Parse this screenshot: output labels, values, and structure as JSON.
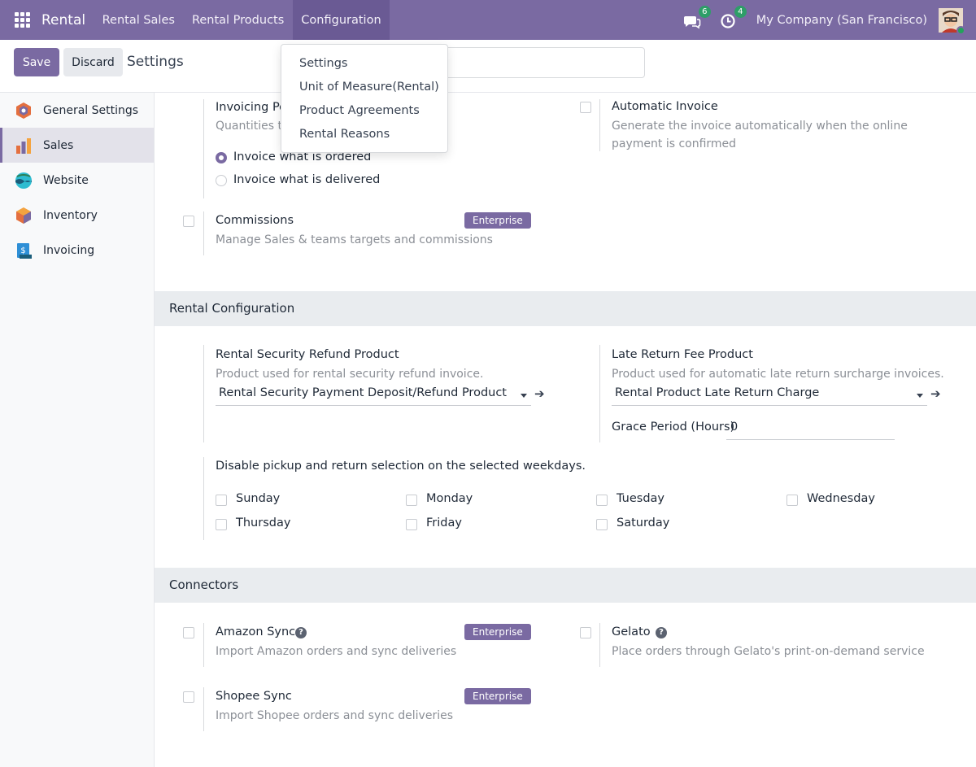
{
  "navbar": {
    "brand": "Rental",
    "menu": [
      "Rental Sales",
      "Rental Products",
      "Configuration"
    ],
    "messages_count": "6",
    "activities_count": "4",
    "company": "My Company (San Francisco)"
  },
  "dropdown": {
    "items": [
      "Settings",
      "Unit of Measure(Rental)",
      "Product Agreements",
      "Rental Reasons"
    ]
  },
  "control": {
    "save_label": "Save",
    "discard_label": "Discard",
    "breadcrumb": "Settings"
  },
  "sidebar": {
    "items": [
      {
        "label": "General Settings",
        "icon": "general-settings-icon",
        "active": false
      },
      {
        "label": "Sales",
        "icon": "sales-icon",
        "active": true
      },
      {
        "label": "Website",
        "icon": "website-icon",
        "active": false
      },
      {
        "label": "Inventory",
        "icon": "inventory-icon",
        "active": false
      },
      {
        "label": "Invoicing",
        "icon": "invoicing-icon",
        "active": false
      }
    ]
  },
  "invoicing_policy": {
    "title_partial": "Invoicing Po",
    "desc_partial": "Quantities t",
    "options": [
      "Invoice what is ordered",
      "Invoice what is delivered"
    ],
    "selected": 0
  },
  "automatic_invoice": {
    "title": "Automatic Invoice",
    "desc": "Generate the invoice automatically when the online payment is confirmed"
  },
  "commissions": {
    "title": "Commissions",
    "desc": "Manage Sales & teams targets and commissions",
    "badge": "Enterprise"
  },
  "rental_config": {
    "section_title": "Rental Configuration",
    "security_refund": {
      "title": "Rental Security Refund Product",
      "desc": "Product used for rental security refund invoice.",
      "value": "Rental Security Payment Deposit/Refund Product"
    },
    "late_return": {
      "title": "Late Return Fee Product",
      "desc": "Product used for automatic late return surcharge invoices.",
      "value": "Rental Product Late Return Charge"
    },
    "grace_period": {
      "label": "Grace Period (Hours)",
      "value": "0"
    },
    "weekdays": {
      "title": "Disable pickup and return selection on the selected weekdays.",
      "days": [
        "Sunday",
        "Monday",
        "Tuesday",
        "Wednesday",
        "Thursday",
        "Friday",
        "Saturday"
      ]
    }
  },
  "connectors": {
    "section_title": "Connectors",
    "amazon": {
      "title": "Amazon Sync",
      "desc": "Import Amazon orders and sync deliveries",
      "badge": "Enterprise"
    },
    "gelato": {
      "title": "Gelato",
      "desc": "Place orders through Gelato's print-on-demand service"
    },
    "shopee": {
      "title": "Shopee Sync",
      "desc": "Import Shopee orders and sync deliveries",
      "badge": "Enterprise"
    }
  },
  "colors": {
    "brand": "#7a6aa2",
    "badge_green": "#2e9e68"
  }
}
